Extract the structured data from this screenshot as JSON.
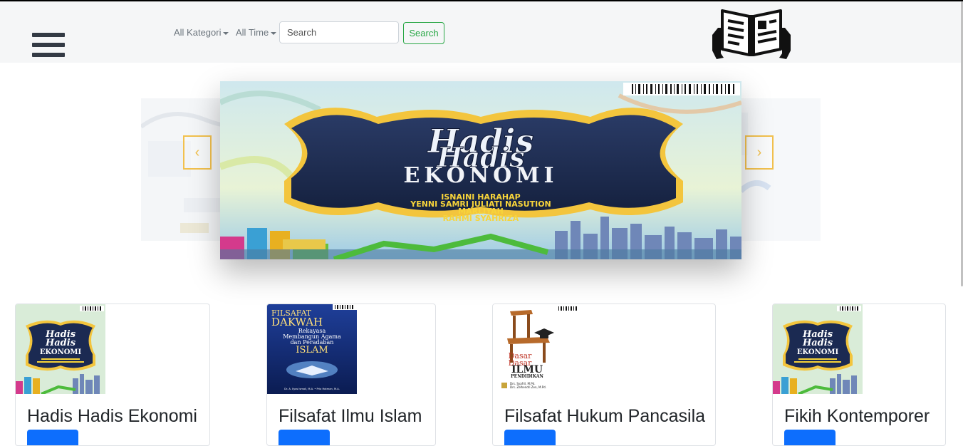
{
  "navbar": {
    "category_label": "All Kategori",
    "time_label": "All Time",
    "search_placeholder": "Search",
    "search_button": "Search"
  },
  "carousel": {
    "active_cover": {
      "title_line1": "Hadis",
      "title_line2": "Hadis",
      "title_line3": "EKONOMI",
      "authors": [
        "ISNAINI HARAHAP",
        "YENNI SAMRI JULIATI NASUTION",
        "MARLIYAH",
        "RAHMI SYAHRIZA"
      ]
    },
    "prev_icon": "chevron-left-icon",
    "next_icon": "chevron-right-icon"
  },
  "books": [
    {
      "title": "Hadis Hadis Ekonomi",
      "cover": {
        "line1": "Hadis",
        "line2": "Hadis",
        "line3": "EKONOMI"
      }
    },
    {
      "title": "Filsafat Ilmu Islam",
      "cover": {
        "line1": "FILSAFAT",
        "line2": "DAKWAH",
        "line3": "Rekayasa",
        "line4": "Membangun Agama",
        "line5": "dan Peradaban",
        "line6": "ISLAM",
        "authors": "Dr. A. Ilyas Ismail, M.A. • Prio Hotman, M.A."
      }
    },
    {
      "title": "Filsafat Hukum Pancasila",
      "cover": {
        "line1": "Dasar",
        "line2": "Dasar",
        "line3": "ILMU",
        "line4": "PENDIDIKAN",
        "authors1": "Drs. Syafril, M.Pd.",
        "authors2": "Drs. Zelhendri Zen, M.Pd."
      }
    },
    {
      "title": "Fikih Kontemporer",
      "cover": {
        "line1": "Hadis",
        "line2": "Hadis",
        "line3": "EKONOMI"
      }
    }
  ],
  "colors": {
    "accent_green": "#28a745",
    "button_blue": "#0d6efd",
    "arrow_gold": "#f2c14e",
    "cover_navy": "#1b2a52"
  }
}
